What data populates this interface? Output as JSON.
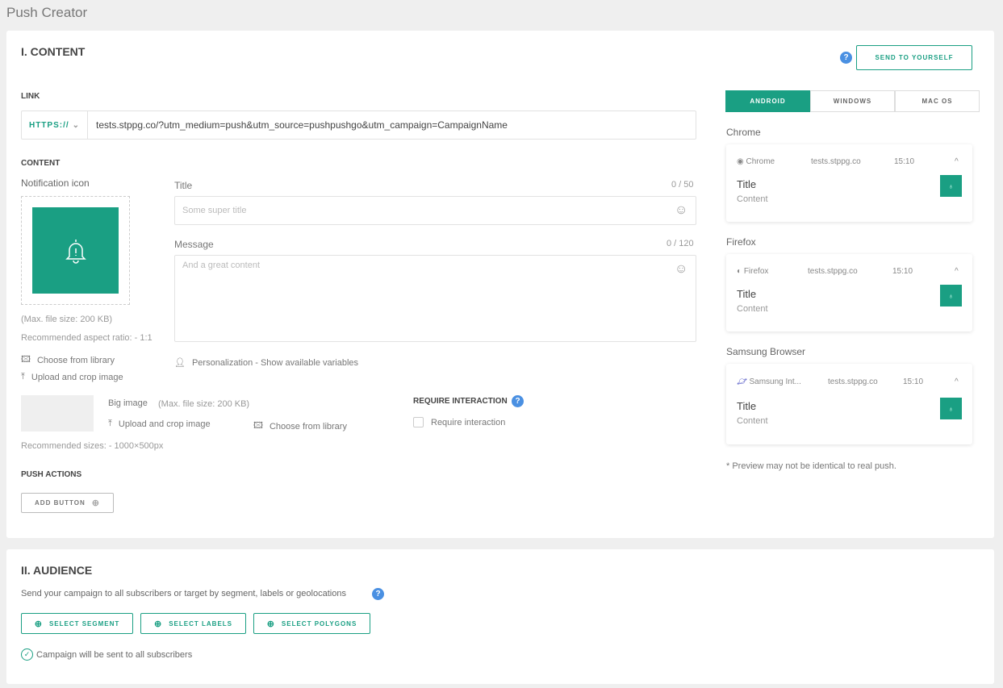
{
  "page_title": "Push Creator",
  "content": {
    "heading": "I. CONTENT",
    "send_yourself": "SEND TO YOURSELF",
    "link_label": "LINK",
    "protocol": "HTTPS://",
    "url": "tests.stppg.co/?utm_medium=push&utm_source=pushpushgo&utm_campaign=CampaignName",
    "content_label": "CONTENT",
    "notification_icon": "Notification icon",
    "max_size": "(Max. file size: 200 KB)",
    "aspect": "Recommended aspect ratio: - 1:1",
    "choose_library": "Choose from library",
    "upload_crop": "Upload and crop image",
    "title_label": "Title",
    "title_count": "0 / 50",
    "title_placeholder": "Some super title",
    "message_label": "Message",
    "message_count": "0 / 120",
    "message_placeholder": "And a great content",
    "personalization": "Personalization - Show available variables",
    "big_image": "Big image",
    "big_image_max": "(Max. file size: 200 KB)",
    "big_upload": "Upload and crop image",
    "big_library": "Choose from library",
    "recommended_sizes": "Recommended sizes: - 1000×500px",
    "require_heading": "REQUIRE INTERACTION",
    "require_checkbox": "Require interaction",
    "require_checked": false,
    "push_actions": "PUSH ACTIONS",
    "add_button": "ADD BUTTON"
  },
  "preview": {
    "tabs": [
      {
        "label": "ANDROID",
        "active": true
      },
      {
        "label": "WINDOWS",
        "active": false
      },
      {
        "label": "MAC OS",
        "active": false
      }
    ],
    "browsers": [
      {
        "section": "Chrome",
        "app": "Chrome",
        "domain": "tests.stppg.co",
        "time": "15:10",
        "title": "Title",
        "content": "Content"
      },
      {
        "section": "Firefox",
        "app": "Firefox",
        "domain": "tests.stppg.co",
        "time": "15:10",
        "title": "Title",
        "content": "Content"
      },
      {
        "section": "Samsung Browser",
        "app": "Samsung Int...",
        "domain": "tests.stppg.co",
        "time": "15:10",
        "title": "Title",
        "content": "Content"
      }
    ],
    "note": "* Preview may not be identical to real push."
  },
  "audience": {
    "heading": "II. AUDIENCE",
    "desc": "Send your campaign to all subscribers or target by segment, labels or geolocations",
    "buttons": [
      "SELECT SEGMENT",
      "SELECT LABELS",
      "SELECT POLYGONS"
    ],
    "status": "Campaign will be sent to all subscribers"
  },
  "colors": {
    "accent": "#1a9f83",
    "help": "#4a90e2"
  }
}
